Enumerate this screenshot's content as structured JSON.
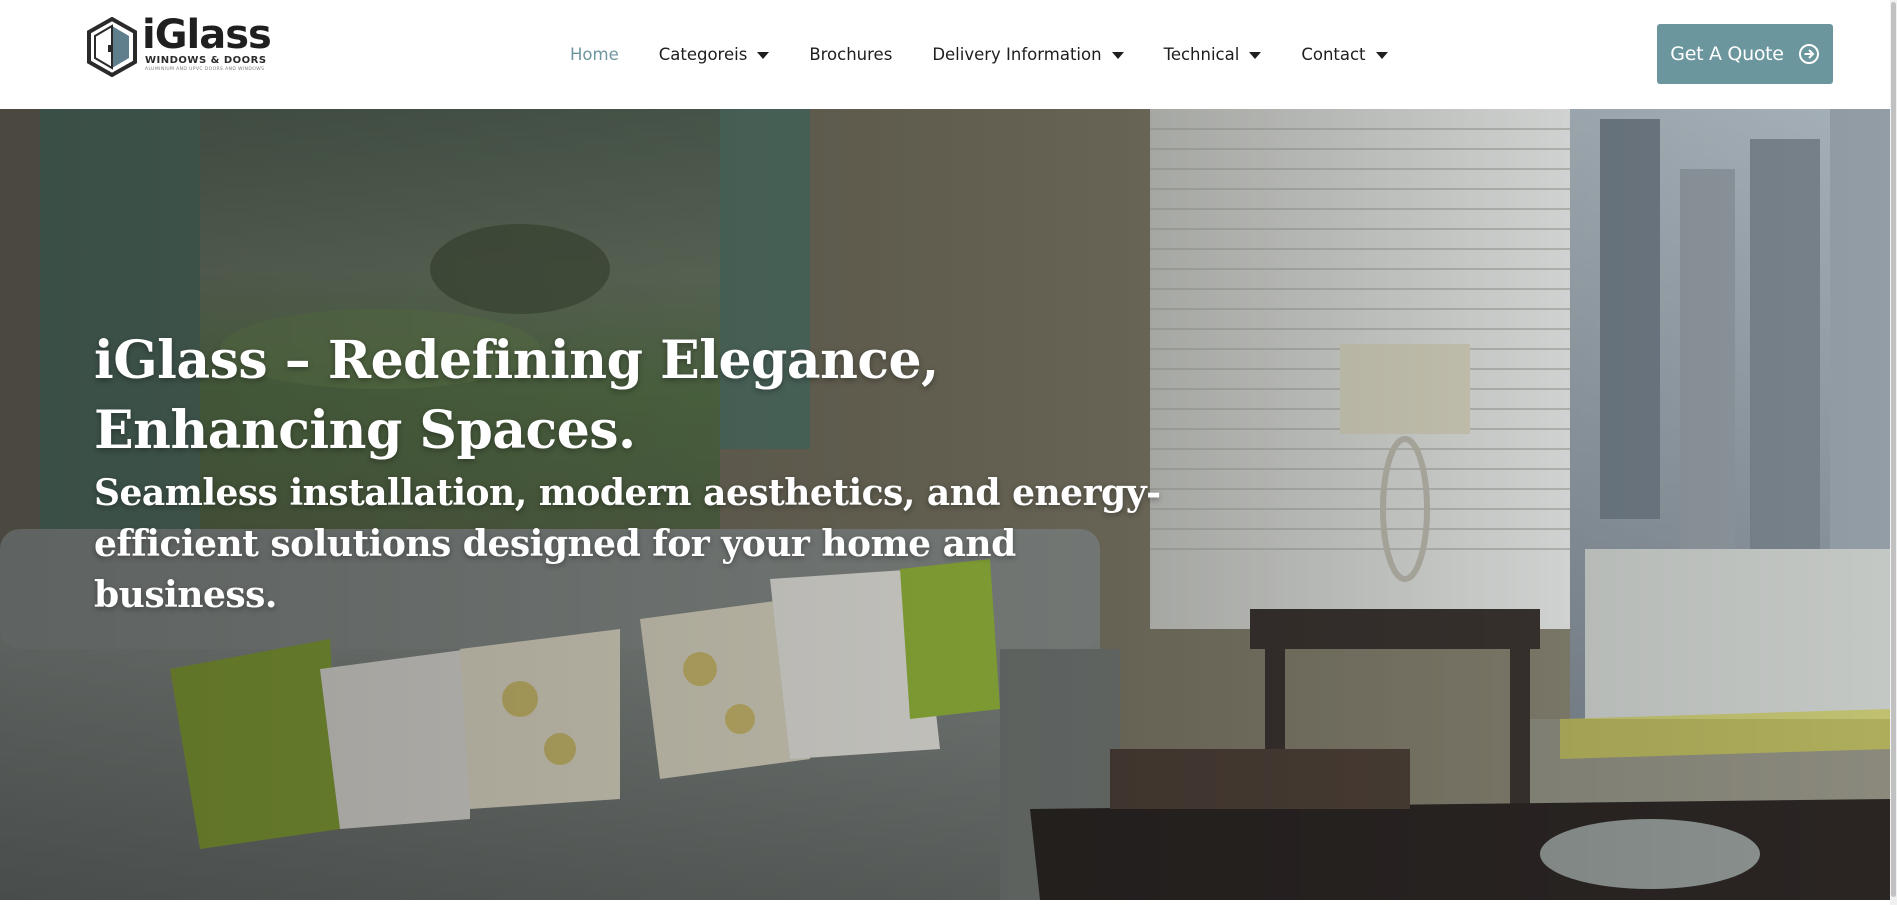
{
  "brand": {
    "name": "iGlass",
    "subtitle": "WINDOWS & DOORS",
    "tagline": "ALUMINIUM AND UPVC DOORS AND WINDOWS"
  },
  "nav": {
    "items": [
      {
        "label": "Home",
        "active": true,
        "dropdown": false
      },
      {
        "label": "Categoreis",
        "active": false,
        "dropdown": true
      },
      {
        "label": "Brochures",
        "active": false,
        "dropdown": false
      },
      {
        "label": "Delivery Information",
        "active": false,
        "dropdown": true
      },
      {
        "label": "Technical",
        "active": false,
        "dropdown": true
      },
      {
        "label": "Contact",
        "active": false,
        "dropdown": true
      }
    ]
  },
  "cta": {
    "label": "Get A Quote",
    "icon": "arrow-circle-right-icon"
  },
  "hero": {
    "title": "iGlass – Redefining Elegance, Enhancing Spaces.",
    "subtitle": "Seamless installation, modern aesthetics, and energy-efficient solutions designed for your home and business.",
    "image": "living-room-photo"
  },
  "colors": {
    "accent": "#6b969d",
    "active_nav": "#6e96a0",
    "text": "#1e1e1e"
  }
}
